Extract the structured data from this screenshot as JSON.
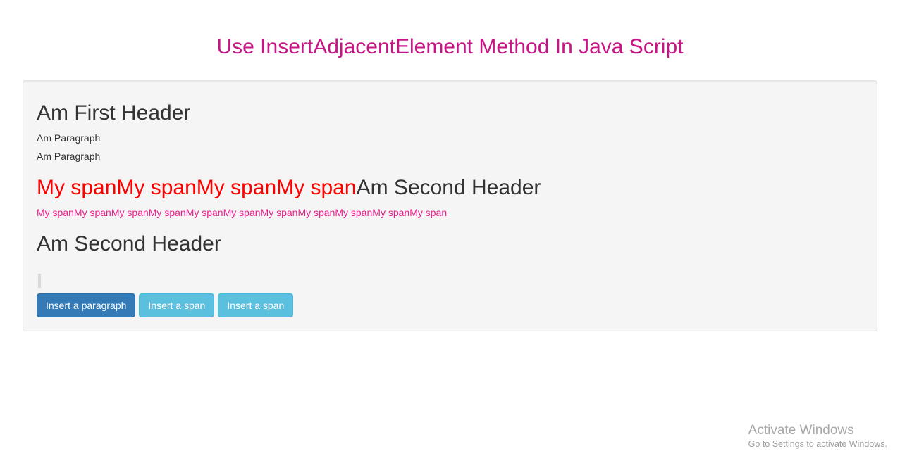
{
  "page_title": "Use InsertAdjacentElement Method In Java Script",
  "well": {
    "header1": "Am First Header",
    "paragraph1": "Am Paragraph",
    "paragraph2": "Am Paragraph",
    "red_spans": [
      "My span",
      "My span",
      "My span",
      "My span"
    ],
    "header2_suffix": "Am Second Header",
    "pink_spans": [
      "My span",
      "My span",
      "My span",
      "My span",
      "My span",
      "My span",
      "My span",
      "My span",
      "My span",
      "My span",
      "My span"
    ],
    "header3": "Am Second Header"
  },
  "buttons": {
    "insert_paragraph": "Insert a paragraph",
    "insert_span_1": "Insert a span",
    "insert_span_2": "Insert a span"
  },
  "watermark": {
    "title": "Activate Windows",
    "subtitle": "Go to Settings to activate Windows."
  }
}
